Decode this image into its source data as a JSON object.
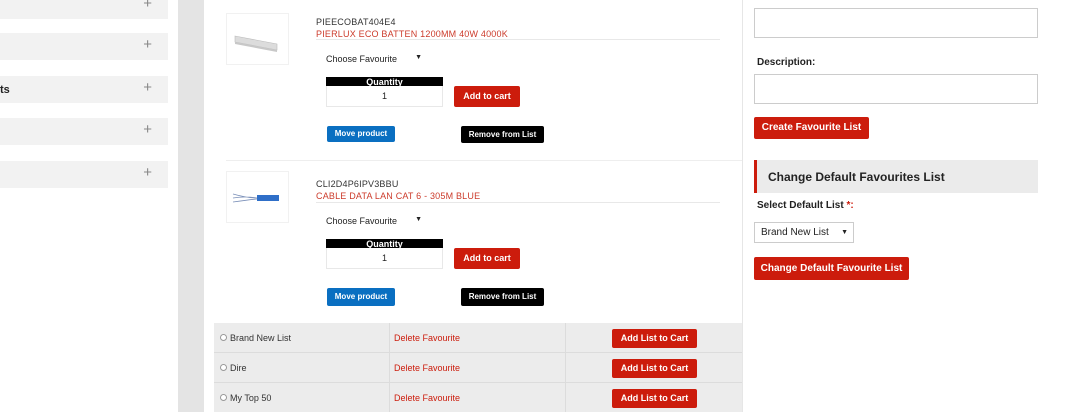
{
  "sidebar": {
    "items": [
      {
        "label": ""
      },
      {
        "label": ""
      },
      {
        "label": "ts"
      },
      {
        "label": ""
      },
      {
        "label": ""
      }
    ],
    "expand_glyph": "+"
  },
  "products": [
    {
      "sku": "PIEECOBAT404E4",
      "name": "PIERLUX ECO BATTEN 1200MM 40W 4000K",
      "favourite_select": "Choose Favourite",
      "quantity_label": "Quantity",
      "quantity": "1",
      "add_to_cart": "Add to cart",
      "move": "Move product",
      "remove": "Remove from List",
      "thumb_icon": "batten-light-icon"
    },
    {
      "sku": "CLI2D4P6IPV3BBU",
      "name": "CABLE DATA LAN CAT 6 - 305M BLUE",
      "favourite_select": "Choose Favourite",
      "quantity_label": "Quantity",
      "quantity": "1",
      "add_to_cart": "Add to cart",
      "move": "Move product",
      "remove": "Remove from List",
      "thumb_icon": "cable-reel-icon"
    }
  ],
  "favourite_lists": [
    {
      "name": "Brand New List",
      "delete": "Delete Favourite",
      "add": "Add List to Cart"
    },
    {
      "name": "Dire",
      "delete": "Delete Favourite",
      "add": "Add List to Cart"
    },
    {
      "name": "My Top 50",
      "delete": "Delete Favourite",
      "add": "Add List to Cart"
    }
  ],
  "right_panel": {
    "description_label": "Description:",
    "create_button": "Create Favourite List",
    "section_title": "Change Default Favourites List",
    "select_default_label": "Select Default List",
    "required_mark": "*:",
    "default_value": "Brand New List",
    "change_button": "Change Default Favourite List"
  },
  "colors": {
    "accent_red": "#cc1c0c",
    "link_red": "#cc3b2b",
    "blue": "#0a6fc1"
  }
}
